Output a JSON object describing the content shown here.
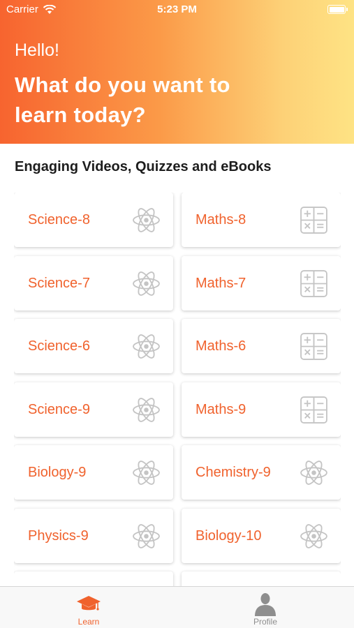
{
  "status_bar": {
    "carrier": "Carrier",
    "time": "5:23 PM"
  },
  "header": {
    "greeting": "Hello!",
    "headline": "What do you want to learn today?"
  },
  "section_title": "Engaging Videos, Quizzes and eBooks",
  "courses": [
    {
      "label": "Science-8",
      "icon": "atom-icon"
    },
    {
      "label": "Maths-8",
      "icon": "calculator-icon"
    },
    {
      "label": "Science-7",
      "icon": "atom-icon"
    },
    {
      "label": "Maths-7",
      "icon": "calculator-icon"
    },
    {
      "label": "Science-6",
      "icon": "atom-icon"
    },
    {
      "label": "Maths-6",
      "icon": "calculator-icon"
    },
    {
      "label": "Science-9",
      "icon": "atom-icon"
    },
    {
      "label": "Maths-9",
      "icon": "calculator-icon"
    },
    {
      "label": "Biology-9",
      "icon": "atom-icon"
    },
    {
      "label": "Chemistry-9",
      "icon": "atom-icon"
    },
    {
      "label": "Physics-9",
      "icon": "atom-icon"
    },
    {
      "label": "Biology-10",
      "icon": "atom-icon"
    },
    {
      "label": "",
      "icon": "atom-icon"
    },
    {
      "label": "",
      "icon": "atom-icon"
    }
  ],
  "tabbar": {
    "learn_label": "Learn",
    "profile_label": "Profile"
  },
  "colors": {
    "accent": "#f0622d",
    "header_gradient_start": "#f7642f",
    "header_gradient_end": "#fee384",
    "icon_gray": "#c4c4c4",
    "tab_inactive": "#8e8e8e"
  }
}
